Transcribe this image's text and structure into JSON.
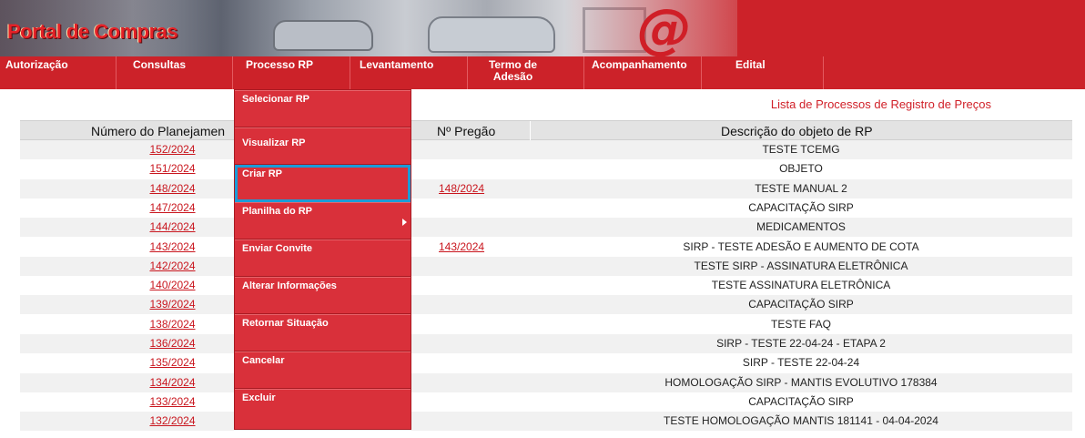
{
  "banner": {
    "logo_text": "Portal de Compras",
    "at_symbol": "@"
  },
  "nav": {
    "items": [
      {
        "label": "Autorização"
      },
      {
        "label": "Consultas"
      },
      {
        "label": "Processo RP"
      },
      {
        "label": "Levantamento"
      },
      {
        "label": "Termo de Adesão"
      },
      {
        "label": "Acompanhamento"
      },
      {
        "label": "Edital"
      }
    ]
  },
  "dropdown": {
    "items": [
      {
        "label": "Selecionar RP"
      },
      {
        "label": "Visualizar RP"
      },
      {
        "label": "Criar RP"
      },
      {
        "label": "Planilha do RP"
      },
      {
        "label": "Enviar Convite"
      },
      {
        "label": "Alterar Informações"
      },
      {
        "label": "Retornar Situação"
      },
      {
        "label": "Cancelar"
      },
      {
        "label": "Excluir"
      }
    ]
  },
  "page": {
    "list_title": "Lista de Processos de Registro de Preços"
  },
  "table": {
    "headers": {
      "numero": "Número do Planejamen",
      "pregao": "Nº Pregão",
      "descricao": "Descrição do objeto de RP"
    },
    "rows": [
      {
        "numero": "152/2024",
        "pregao": "",
        "descricao": "TESTE TCEMG"
      },
      {
        "numero": "151/2024",
        "pregao": "",
        "descricao": "OBJETO"
      },
      {
        "numero": "148/2024",
        "pregao": "148/2024",
        "descricao": "TESTE MANUAL 2"
      },
      {
        "numero": "147/2024",
        "pregao": "",
        "descricao": "CAPACITAÇÃO SIRP"
      },
      {
        "numero": "144/2024",
        "pregao": "",
        "descricao": "MEDICAMENTOS"
      },
      {
        "numero": "143/2024",
        "pregao": "143/2024",
        "descricao": "SIRP - TESTE ADESÃO E AUMENTO DE COTA"
      },
      {
        "numero": "142/2024",
        "pregao": "",
        "descricao": "TESTE SIRP - ASSINATURA ELETRÔNICA"
      },
      {
        "numero": "140/2024",
        "pregao": "",
        "descricao": "TESTE ASSINATURA ELETRÔNICA"
      },
      {
        "numero": "139/2024",
        "pregao": "",
        "descricao": "CAPACITAÇÃO SIRP"
      },
      {
        "numero": "138/2024",
        "pregao": "",
        "descricao": "TESTE FAQ"
      },
      {
        "numero": "136/2024",
        "pregao": "",
        "descricao": "SIRP - TESTE 22-04-24 - ETAPA 2"
      },
      {
        "numero": "135/2024",
        "pregao": "",
        "descricao": "SIRP - TESTE 22-04-24"
      },
      {
        "numero": "134/2024",
        "pregao": "",
        "descricao": "HOMOLOGAÇÃO SIRP - MANTIS EVOLUTIVO 178384"
      },
      {
        "numero": "133/2024",
        "pregao": "",
        "descricao": "CAPACITAÇÃO SIRP"
      },
      {
        "numero": "132/2024",
        "pregao": "",
        "descricao": "TESTE HOMOLOGAÇÃO MANTIS 181141 - 04-04-2024"
      }
    ]
  }
}
